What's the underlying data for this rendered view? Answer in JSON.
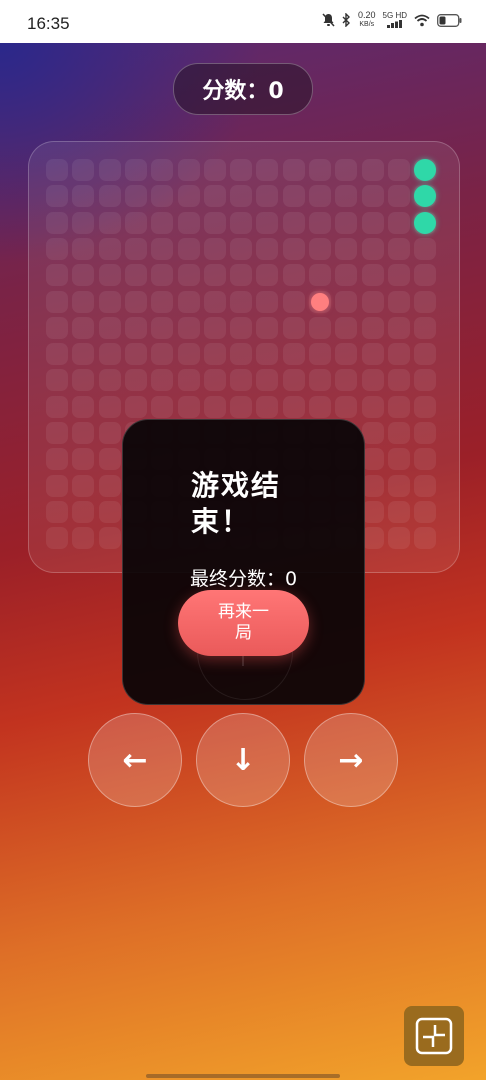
{
  "status_bar": {
    "time": "16:35",
    "net_speed": "0.20",
    "net_speed_unit": "KB/s",
    "network": "5G HD",
    "icons": [
      "mute-icon",
      "bluetooth-icon",
      "signal-icon",
      "wifi-icon",
      "battery-icon"
    ]
  },
  "score_pill": {
    "text": "分数：0"
  },
  "board": {
    "grid_size": 15,
    "snake_cells": [
      [
        14,
        0
      ],
      [
        14,
        1
      ],
      [
        14,
        2
      ]
    ],
    "food_cell": [
      10,
      5
    ]
  },
  "game_over": {
    "title": "游戏结束！",
    "final_score": "最终分数：0",
    "replay_label": "再来一局"
  },
  "controls": {
    "left": "←",
    "down": "↓",
    "right": "→"
  },
  "colors": {
    "snake": "#2fd8a8",
    "food": "#ff7f7f",
    "replay_button": "#f06666"
  }
}
